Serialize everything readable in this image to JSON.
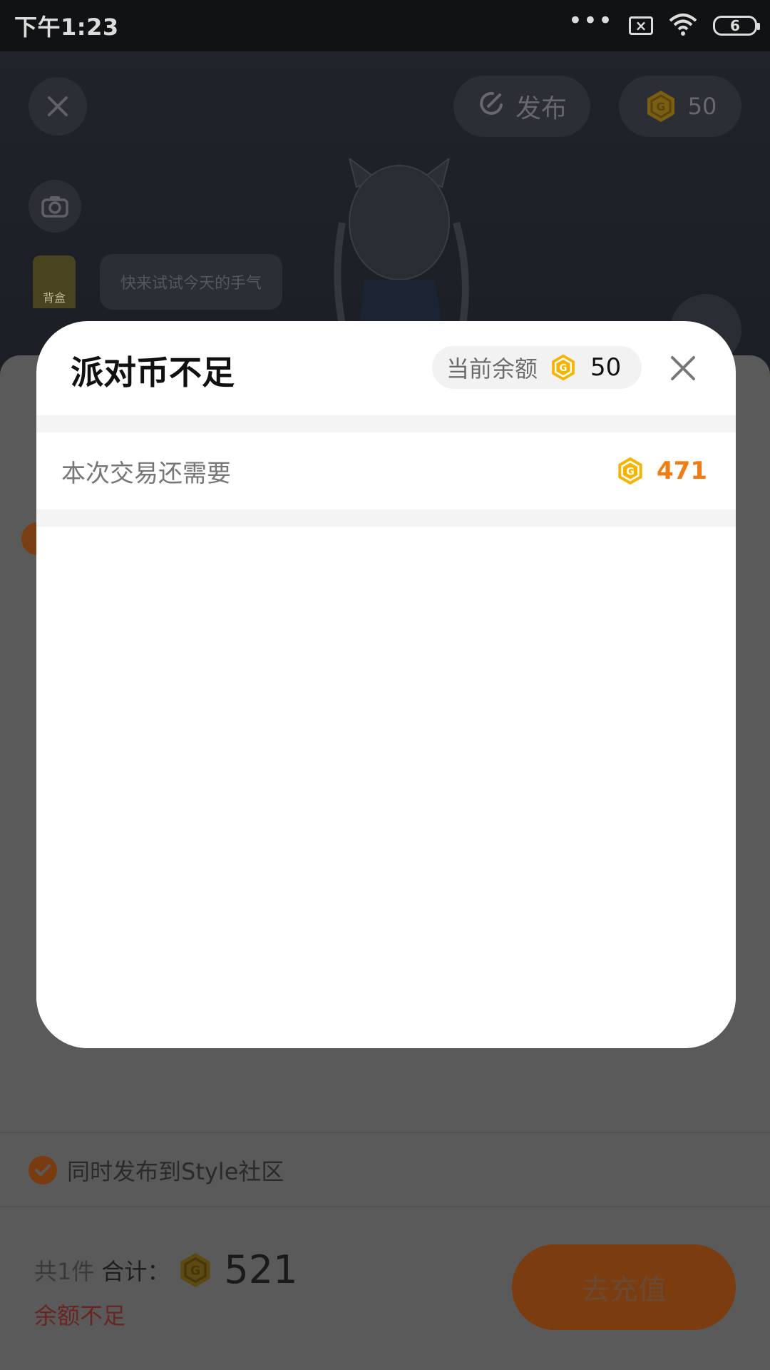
{
  "status_bar": {
    "time": "下午1:23",
    "dots": "•••",
    "notification_x": "×",
    "battery_level": "6"
  },
  "background": {
    "publish_label": "发布",
    "coin_balance": "50",
    "avatar_label": "背盒",
    "speech_bubble": "快来试试今天的手气"
  },
  "modal": {
    "title": "派对币不足",
    "balance_label": "当前余额",
    "balance_value": "50",
    "need_label": "本次交易还需要",
    "need_value": "471"
  },
  "sheet": {
    "publish_option": "同时发布到Style社区",
    "item_count": "共1件",
    "total_label": "合计：",
    "total_value": "521",
    "insufficient": "余额不足",
    "recharge_button": "去充值"
  },
  "colors": {
    "accent": "#f07d14",
    "coin": "#f5b400",
    "overlay": "#5a5a5a"
  },
  "icons": [
    "close-icon",
    "camera-icon",
    "publish-icon",
    "coin-icon",
    "check-icon",
    "wifi-icon",
    "battery-icon"
  ]
}
